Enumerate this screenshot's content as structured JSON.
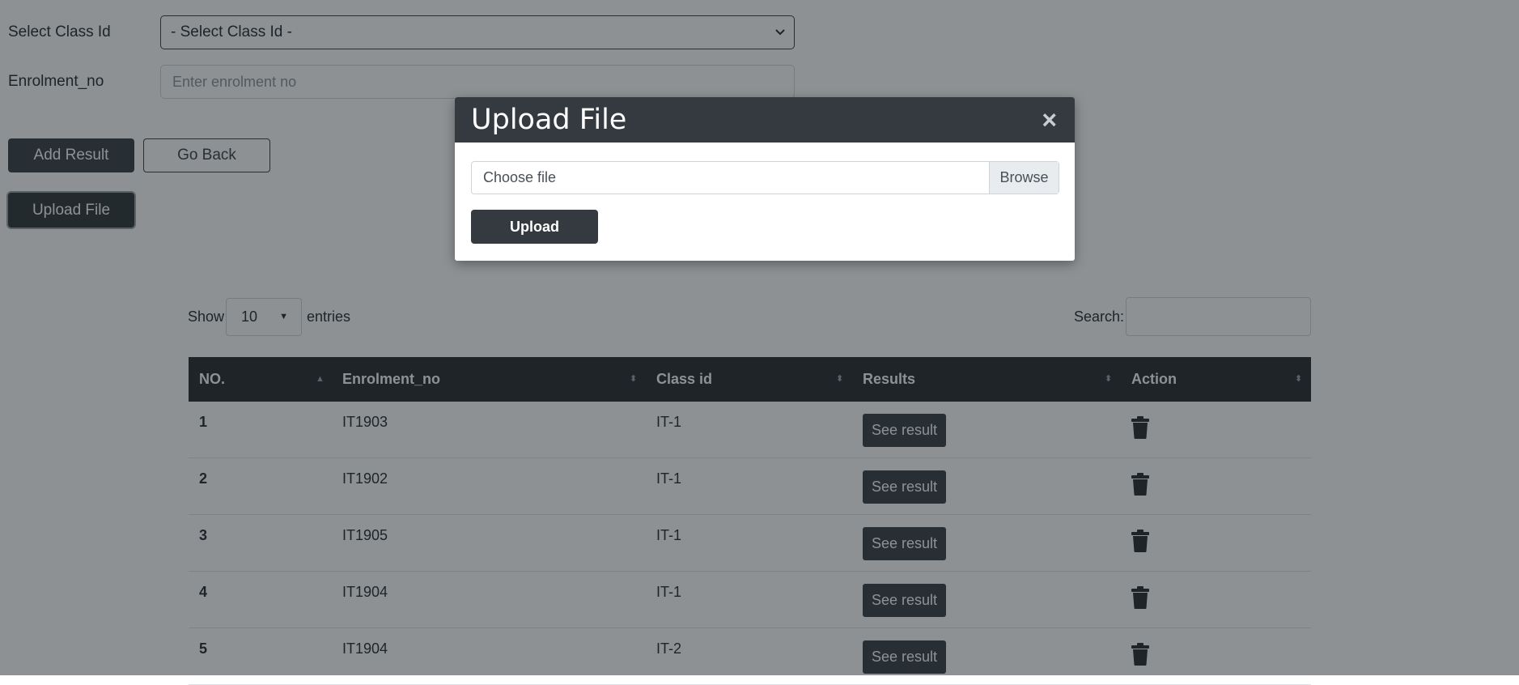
{
  "form": {
    "class_label": "Select Class Id",
    "class_selected": "- Select Class Id -",
    "enrol_label": "Enrolment_no",
    "enrol_placeholder": "Enter enrolment no",
    "add_result_label": "Add Result",
    "go_back_label": "Go Back",
    "upload_file_label": "Upload File"
  },
  "table_controls": {
    "show_label": "Show",
    "entries_value": "10",
    "entries_label": "entries",
    "search_label": "Search:"
  },
  "table": {
    "headers": [
      "NO.",
      "Enrolment_no",
      "Class id",
      "Results",
      "Action"
    ],
    "see_result_label": "See result",
    "rows": [
      {
        "no": "1",
        "enrolment": "IT1903",
        "class_id": "IT-1"
      },
      {
        "no": "2",
        "enrolment": "IT1902",
        "class_id": "IT-1"
      },
      {
        "no": "3",
        "enrolment": "IT1905",
        "class_id": "IT-1"
      },
      {
        "no": "4",
        "enrolment": "IT1904",
        "class_id": "IT-1"
      },
      {
        "no": "5",
        "enrolment": "IT1904",
        "class_id": "IT-2"
      }
    ]
  },
  "modal": {
    "title": "Upload File",
    "close_symbol": "×",
    "file_placeholder": "Choose file",
    "browse_label": "Browse",
    "upload_label": "Upload"
  },
  "colors": {
    "dark": "#343a40",
    "table_header": "#212529",
    "backdrop": "rgba(28,36,40,0.5)"
  }
}
